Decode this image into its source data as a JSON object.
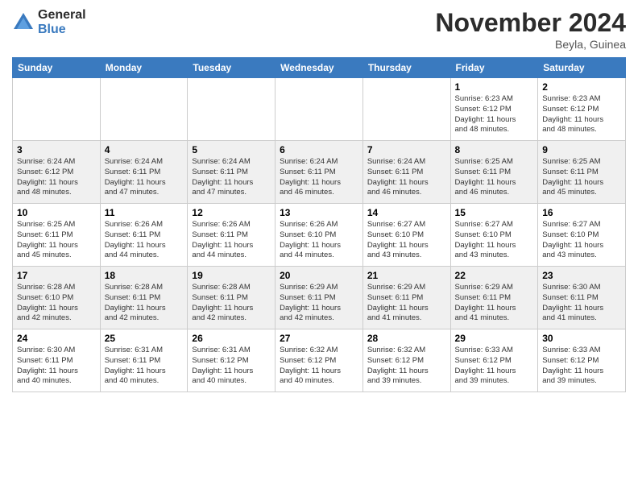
{
  "header": {
    "logo_general": "General",
    "logo_blue": "Blue",
    "month_title": "November 2024",
    "location": "Beyla, Guinea"
  },
  "weekdays": [
    "Sunday",
    "Monday",
    "Tuesday",
    "Wednesday",
    "Thursday",
    "Friday",
    "Saturday"
  ],
  "weeks": [
    [
      {
        "day": "",
        "info": ""
      },
      {
        "day": "",
        "info": ""
      },
      {
        "day": "",
        "info": ""
      },
      {
        "day": "",
        "info": ""
      },
      {
        "day": "",
        "info": ""
      },
      {
        "day": "1",
        "info": "Sunrise: 6:23 AM\nSunset: 6:12 PM\nDaylight: 11 hours\nand 48 minutes."
      },
      {
        "day": "2",
        "info": "Sunrise: 6:23 AM\nSunset: 6:12 PM\nDaylight: 11 hours\nand 48 minutes."
      }
    ],
    [
      {
        "day": "3",
        "info": "Sunrise: 6:24 AM\nSunset: 6:12 PM\nDaylight: 11 hours\nand 48 minutes."
      },
      {
        "day": "4",
        "info": "Sunrise: 6:24 AM\nSunset: 6:11 PM\nDaylight: 11 hours\nand 47 minutes."
      },
      {
        "day": "5",
        "info": "Sunrise: 6:24 AM\nSunset: 6:11 PM\nDaylight: 11 hours\nand 47 minutes."
      },
      {
        "day": "6",
        "info": "Sunrise: 6:24 AM\nSunset: 6:11 PM\nDaylight: 11 hours\nand 46 minutes."
      },
      {
        "day": "7",
        "info": "Sunrise: 6:24 AM\nSunset: 6:11 PM\nDaylight: 11 hours\nand 46 minutes."
      },
      {
        "day": "8",
        "info": "Sunrise: 6:25 AM\nSunset: 6:11 PM\nDaylight: 11 hours\nand 46 minutes."
      },
      {
        "day": "9",
        "info": "Sunrise: 6:25 AM\nSunset: 6:11 PM\nDaylight: 11 hours\nand 45 minutes."
      }
    ],
    [
      {
        "day": "10",
        "info": "Sunrise: 6:25 AM\nSunset: 6:11 PM\nDaylight: 11 hours\nand 45 minutes."
      },
      {
        "day": "11",
        "info": "Sunrise: 6:26 AM\nSunset: 6:11 PM\nDaylight: 11 hours\nand 44 minutes."
      },
      {
        "day": "12",
        "info": "Sunrise: 6:26 AM\nSunset: 6:11 PM\nDaylight: 11 hours\nand 44 minutes."
      },
      {
        "day": "13",
        "info": "Sunrise: 6:26 AM\nSunset: 6:10 PM\nDaylight: 11 hours\nand 44 minutes."
      },
      {
        "day": "14",
        "info": "Sunrise: 6:27 AM\nSunset: 6:10 PM\nDaylight: 11 hours\nand 43 minutes."
      },
      {
        "day": "15",
        "info": "Sunrise: 6:27 AM\nSunset: 6:10 PM\nDaylight: 11 hours\nand 43 minutes."
      },
      {
        "day": "16",
        "info": "Sunrise: 6:27 AM\nSunset: 6:10 PM\nDaylight: 11 hours\nand 43 minutes."
      }
    ],
    [
      {
        "day": "17",
        "info": "Sunrise: 6:28 AM\nSunset: 6:10 PM\nDaylight: 11 hours\nand 42 minutes."
      },
      {
        "day": "18",
        "info": "Sunrise: 6:28 AM\nSunset: 6:11 PM\nDaylight: 11 hours\nand 42 minutes."
      },
      {
        "day": "19",
        "info": "Sunrise: 6:28 AM\nSunset: 6:11 PM\nDaylight: 11 hours\nand 42 minutes."
      },
      {
        "day": "20",
        "info": "Sunrise: 6:29 AM\nSunset: 6:11 PM\nDaylight: 11 hours\nand 42 minutes."
      },
      {
        "day": "21",
        "info": "Sunrise: 6:29 AM\nSunset: 6:11 PM\nDaylight: 11 hours\nand 41 minutes."
      },
      {
        "day": "22",
        "info": "Sunrise: 6:29 AM\nSunset: 6:11 PM\nDaylight: 11 hours\nand 41 minutes."
      },
      {
        "day": "23",
        "info": "Sunrise: 6:30 AM\nSunset: 6:11 PM\nDaylight: 11 hours\nand 41 minutes."
      }
    ],
    [
      {
        "day": "24",
        "info": "Sunrise: 6:30 AM\nSunset: 6:11 PM\nDaylight: 11 hours\nand 40 minutes."
      },
      {
        "day": "25",
        "info": "Sunrise: 6:31 AM\nSunset: 6:11 PM\nDaylight: 11 hours\nand 40 minutes."
      },
      {
        "day": "26",
        "info": "Sunrise: 6:31 AM\nSunset: 6:12 PM\nDaylight: 11 hours\nand 40 minutes."
      },
      {
        "day": "27",
        "info": "Sunrise: 6:32 AM\nSunset: 6:12 PM\nDaylight: 11 hours\nand 40 minutes."
      },
      {
        "day": "28",
        "info": "Sunrise: 6:32 AM\nSunset: 6:12 PM\nDaylight: 11 hours\nand 39 minutes."
      },
      {
        "day": "29",
        "info": "Sunrise: 6:33 AM\nSunset: 6:12 PM\nDaylight: 11 hours\nand 39 minutes."
      },
      {
        "day": "30",
        "info": "Sunrise: 6:33 AM\nSunset: 6:12 PM\nDaylight: 11 hours\nand 39 minutes."
      }
    ]
  ]
}
